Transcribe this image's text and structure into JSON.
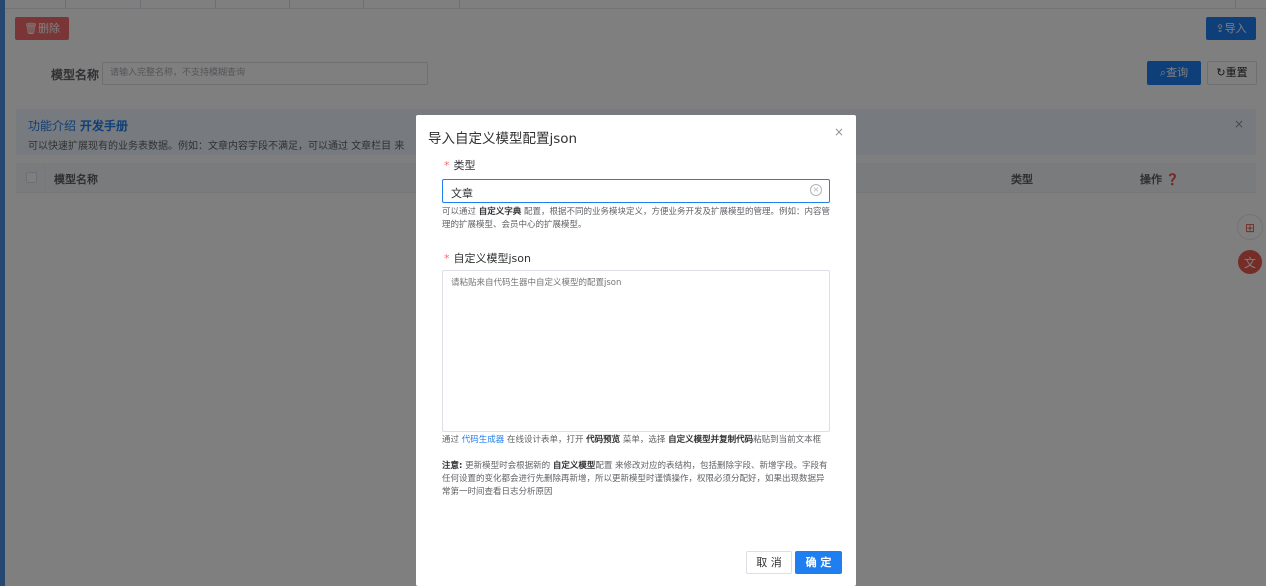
{
  "toolbar": {
    "delete_label": "删除",
    "import_label": "导入"
  },
  "search": {
    "model_name_label": "模型名称",
    "model_name_placeholder": "请输入完整名称，不支持模糊查询",
    "query_label": "查询",
    "reset_label": "重置"
  },
  "info": {
    "title": "功能介绍",
    "link": "开发手册",
    "description": "可以快速扩展现有的业务表数据。例如：文章内容字段不满足，可以通过 文章栏目 来",
    "close": "×"
  },
  "table": {
    "col_name": "模型名称",
    "col_type": "类型",
    "col_action": "操作"
  },
  "dialog": {
    "title": "导入自定义模型配置json",
    "close": "×",
    "type_label": "类型",
    "type_value": "文章",
    "type_help_pre": "可以通过",
    "type_help_bold": "自定义字典",
    "type_help_post": "配置，根据不同的业务模块定义，方便业务开发及扩展模型的管理。例如：内容管理的扩展模型、会员中心的扩展模型。",
    "json_label": "自定义模型json",
    "json_placeholder": "请粘贴来自代码生器中自定义模型的配置json",
    "json_help1_pre": "通过",
    "json_help1_link": "代码生成器",
    "json_help1_mid1": "在线设计表单，打开",
    "json_help1_bold1": "代码预览",
    "json_help1_mid2": "菜单，选择",
    "json_help1_bold2": "自定义模型并复制代码",
    "json_help1_post": "粘贴到当前文本框",
    "json_help2_bold1": "注意:",
    "json_help2_mid1": "更新模型时会根据新的",
    "json_help2_bold2": "自定义模型",
    "json_help2_post": "配置 来修改对应的表结构，包括删除字段、新增字段。字段有任何设置的变化都会进行先删除再新增，所以更新模型时谨慎操作，权限必须分配好，如果出现数据异常第一时间查看日志分析原因",
    "cancel_label": "取 消",
    "ok_label": "确 定"
  },
  "colors": {
    "primary": "#1f7ef0",
    "danger": "#f56c6c",
    "required": "#f56c6c"
  }
}
